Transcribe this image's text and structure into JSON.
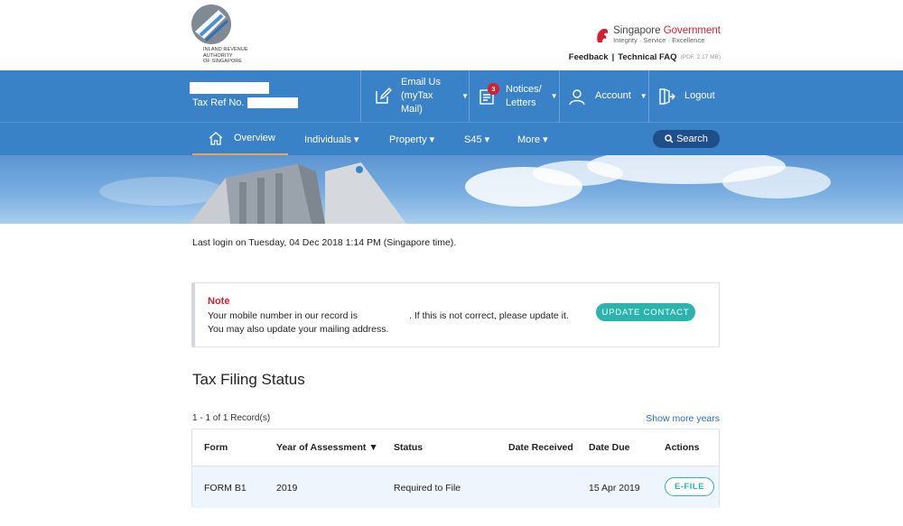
{
  "header": {
    "logo_text_lines": [
      "INLAND REVENUE",
      "AUTHORITY",
      "OF SINGAPORE"
    ],
    "sg_gov_name_1": "Singapore",
    "sg_gov_name_2": "Government",
    "sg_gov_tagline": "Integrity · Service · Excellence",
    "feedback_label": "Feedback",
    "separator": "|",
    "faq_label": "Technical FAQ",
    "faq_meta": "(PDF, 2.17 MB)"
  },
  "account_bar": {
    "tax_ref_label": "Tax Ref No.",
    "email_label_1": "Email Us",
    "email_label_2": "(myTax Mail)",
    "notices_label_1": "Notices/",
    "notices_label_2": "Letters",
    "notices_badge": "3",
    "account_label": "Account",
    "logout_label": "Logout"
  },
  "nav": {
    "items": [
      {
        "label": "Overview"
      },
      {
        "label": "Individuals ▾"
      },
      {
        "label": "Property ▾"
      },
      {
        "label": "S45 ▾"
      },
      {
        "label": "More ▾"
      }
    ],
    "search_label": "Search"
  },
  "main": {
    "last_login": "Last login on Tuesday, 04 Dec 2018 1:14 PM (Singapore time).",
    "note": {
      "title": "Note",
      "line1a": "Your mobile number in our record is",
      "line1b": ". If this is not correct, please update it.",
      "line2": "You may also update your mailing address.",
      "button": "UPDATE CONTACT"
    },
    "section_title": "Tax Filing Status",
    "records_text": "1 - 1 of 1 Record(s)",
    "show_more": "Show more years",
    "table": {
      "headers": [
        "Form",
        "Year of Assessment ▼",
        "Status",
        "Date Received",
        "Date Due",
        "Actions"
      ],
      "rows": [
        {
          "form": "FORM B1",
          "year": "2019",
          "status": "Required to File",
          "received": "",
          "due": "15 Apr 2019",
          "action": "E-FILE"
        }
      ]
    }
  },
  "colors": {
    "bar_blue": "#3a82c8",
    "accent_red": "#d81e2e",
    "teal": "#2bb3ae",
    "link_blue": "#2c6fb7"
  }
}
